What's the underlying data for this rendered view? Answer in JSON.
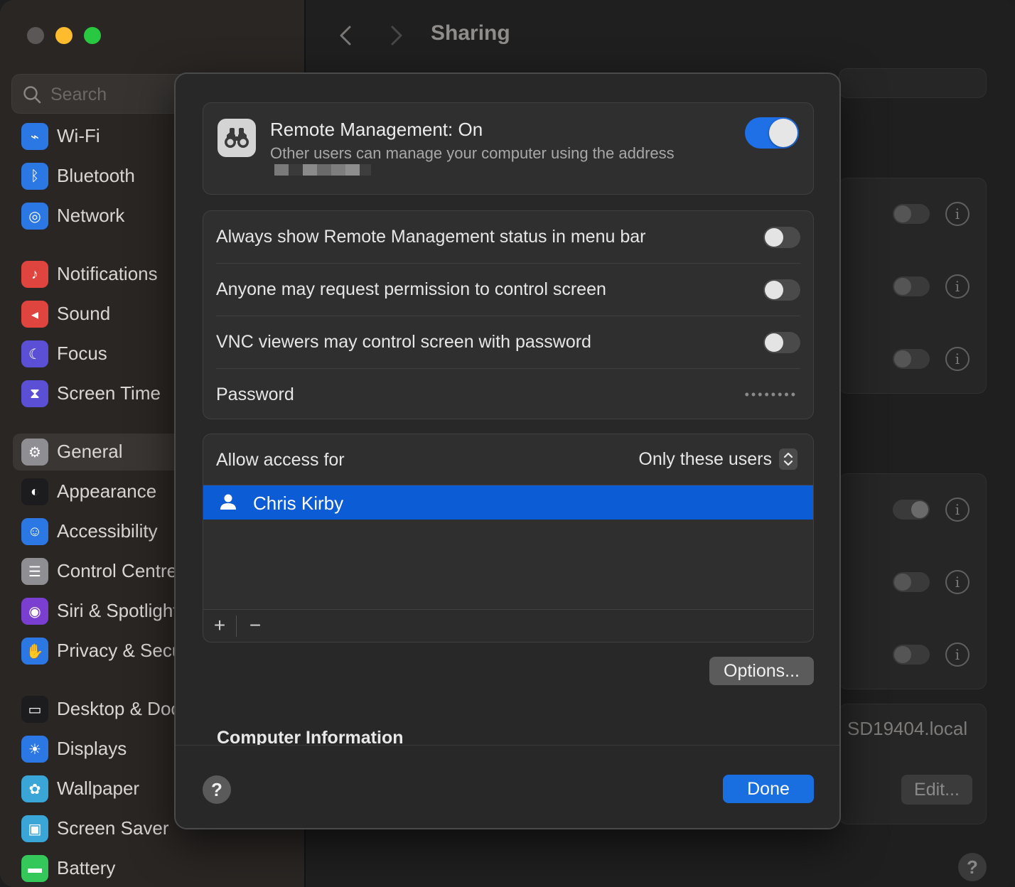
{
  "window": {
    "title": "Sharing"
  },
  "sidebar": {
    "search_placeholder": "Search",
    "items": [
      {
        "label": "Wi-Fi",
        "icon": "wifi-icon",
        "color": "#2b78e4"
      },
      {
        "label": "Bluetooth",
        "icon": "bluetooth-icon",
        "color": "#2b78e4"
      },
      {
        "label": "Network",
        "icon": "globe-icon",
        "color": "#2b78e4"
      },
      {
        "label": "Notifications",
        "icon": "bell-icon",
        "color": "#e0443e"
      },
      {
        "label": "Sound",
        "icon": "speaker-icon",
        "color": "#e0443e"
      },
      {
        "label": "Focus",
        "icon": "moon-icon",
        "color": "#5b4fd6"
      },
      {
        "label": "Screen Time",
        "icon": "hourglass-icon",
        "color": "#5b4fd6"
      },
      {
        "label": "General",
        "icon": "gear-icon",
        "color": "#8e8e93"
      },
      {
        "label": "Appearance",
        "icon": "appearance-icon",
        "color": "#1c1c1e"
      },
      {
        "label": "Accessibility",
        "icon": "accessibility-icon",
        "color": "#2b78e4"
      },
      {
        "label": "Control Centre",
        "icon": "control-centre-icon",
        "color": "#8e8e93"
      },
      {
        "label": "Siri & Spotlight",
        "icon": "siri-icon",
        "color": "#7a3fd1"
      },
      {
        "label": "Privacy & Security",
        "icon": "hand-icon",
        "color": "#2b78e4"
      },
      {
        "label": "Desktop & Dock",
        "icon": "dock-icon",
        "color": "#1c1c1e"
      },
      {
        "label": "Displays",
        "icon": "sun-icon",
        "color": "#2b78e4"
      },
      {
        "label": "Wallpaper",
        "icon": "flower-icon",
        "color": "#3aa6d8"
      },
      {
        "label": "Screen Saver",
        "icon": "screensaver-icon",
        "color": "#3aa6d8"
      },
      {
        "label": "Battery",
        "icon": "battery-icon",
        "color": "#34c759"
      }
    ],
    "selected": "General"
  },
  "background": {
    "hostname": "SD19404.local",
    "edit_label": "Edit...",
    "help_label": "?",
    "info_label": "i"
  },
  "sheet": {
    "remote_management": {
      "title": "Remote Management: On",
      "subtitle": "Other users can manage your computer using the address",
      "enabled": true
    },
    "options": [
      {
        "label": "Always show Remote Management status in menu bar",
        "enabled": false
      },
      {
        "label": "Anyone may request permission to control screen",
        "enabled": false
      },
      {
        "label": "VNC viewers may control screen with password",
        "enabled": false
      }
    ],
    "password": {
      "label": "Password",
      "value": "••••••••"
    },
    "access": {
      "label": "Allow access for",
      "value": "Only these users",
      "users": [
        "Chris Kirby"
      ],
      "add_label": "+",
      "remove_label": "−"
    },
    "options_button": "Options...",
    "computer_info_title": "Computer Information",
    "help_label": "?",
    "done_label": "Done"
  },
  "colors": {
    "accent": "#0b5cd5",
    "toggle_on": "#1f6fe6"
  }
}
